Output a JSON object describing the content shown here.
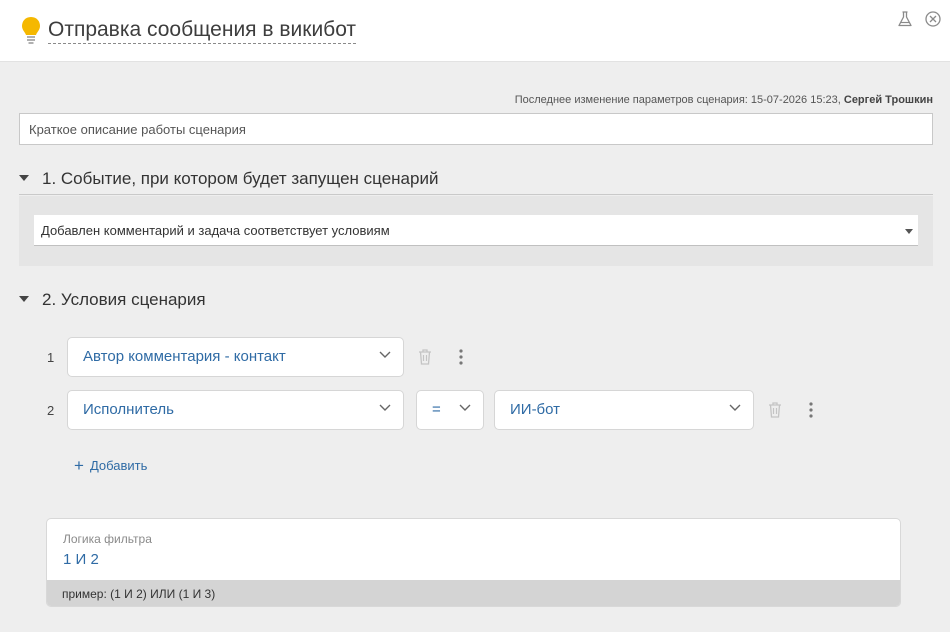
{
  "header": {
    "title": "Отправка сообщения в викибот",
    "icons": [
      "lightbulb-icon",
      "flask-icon",
      "close-icon"
    ],
    "accent_color": "#f5b800"
  },
  "meta": {
    "prefix": "Последнее изменение параметров сценария: 15-07-2026 15:23,",
    "author": "Сергей Трошкин"
  },
  "description": {
    "value": "Краткое описание работы сценария"
  },
  "section1": {
    "title": "1. Событие, при котором будет запущен сценарий",
    "event_value": "Добавлен комментарий и задача соответствует условиям"
  },
  "section2": {
    "title": "2. Условия сценария",
    "conditions": [
      {
        "num": "1",
        "field": "Автор комментария - контакт"
      },
      {
        "num": "2",
        "field": "Исполнитель",
        "operator": "=",
        "value": "ИИ-бот"
      }
    ],
    "add_label": "Добавить"
  },
  "logic": {
    "label": "Логика фильтра",
    "value": "1 И 2",
    "hint": "пример: (1 И 2) ИЛИ (1 И 3)"
  },
  "colors": {
    "link": "#2f6ba5",
    "panel": "#eeeeee"
  }
}
